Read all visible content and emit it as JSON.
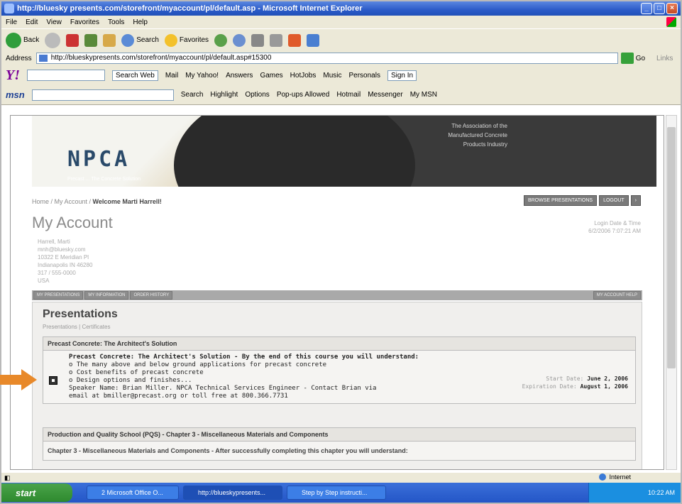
{
  "window": {
    "title": "http://bluesky presents.com/storefront/myaccount/pl/default.asp - Microsoft Internet Explorer"
  },
  "menu": [
    "File",
    "Edit",
    "View",
    "Favorites",
    "Tools",
    "Help"
  ],
  "toolbar": {
    "back": "Back",
    "search": "Search",
    "favorites": "Favorites"
  },
  "address": {
    "label": "Address",
    "url": "http://blueskypresents.com/storefront/myaccount/pl/default.asp#15300",
    "go": "Go",
    "links": "Links"
  },
  "yahoo": {
    "search_btn": "Search Web",
    "items": [
      "Mail",
      "My Yahoo!",
      "Answers",
      "Games",
      "HotJobs",
      "Music",
      "Personals"
    ],
    "signin": "Sign In"
  },
  "msn": {
    "logo": "msn",
    "items": [
      "Search",
      "Highlight",
      "Options",
      "Pop-ups Allowed",
      "Hotmail",
      "Messenger",
      "My MSN"
    ]
  },
  "banner": {
    "logo": "NPCA",
    "tagline": "Precast ... The Concrete Solution",
    "assoc": [
      "The Association of the",
      "Manufactured Concrete",
      "Products Industry"
    ]
  },
  "page": {
    "breadcrumb_prefix": "Home / My Account / ",
    "breadcrumb_current": "Welcome Marti Harrell!",
    "top_buttons": [
      "BROWSE PRESENTATIONS",
      "LOGOUT"
    ],
    "heading": "My Account",
    "login_label": "Login Date & Time",
    "login_value": "6/2/2006 7:07:21 AM",
    "address_lines": [
      "Harrell, Marti",
      "mnh@bluesky.com",
      "10322 E Meridian Pl",
      "Indianapolis IN 46280",
      "317 / 555-0000",
      "USA"
    ],
    "nav_tabs": [
      "MY PRESENTATIONS",
      "MY INFORMATION",
      "ORDER HISTORY"
    ],
    "nav_right": "MY ACCOUNT HELP"
  },
  "presentations": {
    "heading": "Presentations",
    "sub_links": "Presentations | Certificates",
    "course1": {
      "header": "Precast Concrete: The Architect's Solution",
      "title": "Precast Concrete: The Architect's Solution - By the end of this course you will understand:",
      "bullets": [
        "o The many above and below ground applications for precast concrete",
        "o Cost benefits of precast concrete",
        "o Design options and finishes..."
      ],
      "speaker": "Speaker Name: Brian Miller. NPCA Technical Services Engineer - Contact Brian via",
      "email": "email at bmiller@precast.org or toll free at 800.366.7731",
      "start_label": "Start Date:",
      "start_value": "June 2, 2006",
      "exp_label": "Expiration Date:",
      "exp_value": "August 1, 2006"
    },
    "course2": {
      "header": "Production and Quality School (PQS) - Chapter 3 - Miscellaneous Materials and Components",
      "line": "Chapter 3 - Miscellaneous Materials and Components - After successfully completing this chapter you will understand:"
    }
  },
  "status": {
    "zone": "Internet"
  },
  "taskbar": {
    "start": "start",
    "tasks": [
      "2 Microsoft Office O...",
      "http://blueskypresents...",
      "Step by Step instructi..."
    ],
    "clock": "10:22 AM"
  },
  "colors": {
    "accent_arrow": "#e8892a",
    "banner_dark": "#3a3a3a",
    "nav_gray": "#a9a9a9"
  }
}
